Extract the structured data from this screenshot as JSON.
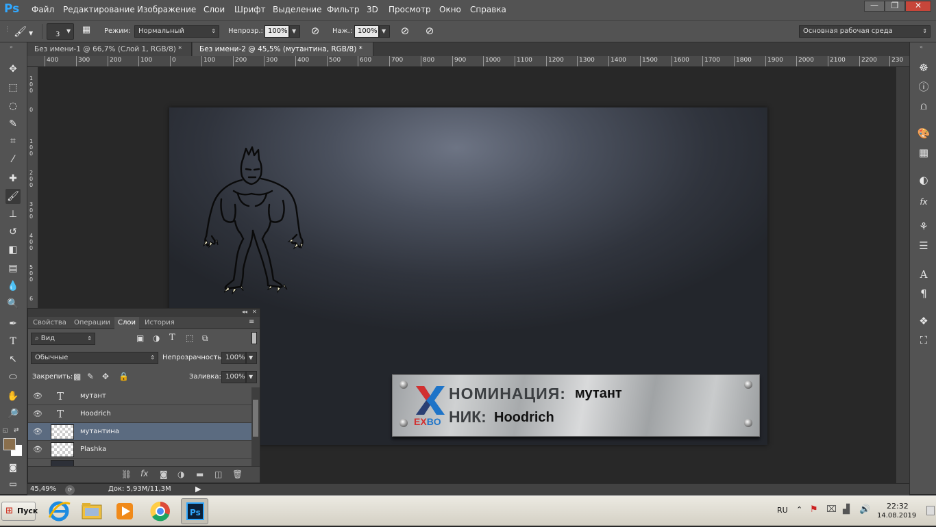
{
  "app": {
    "logo": "Ps",
    "name": "Photoshop"
  },
  "menu": [
    "Файл",
    "Редактирование",
    "Изображение",
    "Слои",
    "Шрифт",
    "Выделение",
    "Фильтр",
    "3D",
    "Просмотр",
    "Окно",
    "Справка"
  ],
  "window_buttons": {
    "minimize": "—",
    "restore": "❐",
    "close": "✕"
  },
  "options": {
    "brush_size": "3",
    "mode_label": "Режим:",
    "mode_value": "Нормальный",
    "opacity_label": "Непрозр.:",
    "opacity_value": "100%",
    "pressure_label": "Наж.:",
    "pressure_value": "100%",
    "workspace": "Основная рабочая среда"
  },
  "doc_tabs": [
    {
      "label": "Без имени-1 @ 66,7% (Слой 1, RGB/8) *",
      "close": "×"
    },
    {
      "label": "Без имени-2 @ 45,5% (мутантина, RGB/8) *",
      "close": "×"
    }
  ],
  "ruler_h": [
    "400",
    "300",
    "200",
    "100",
    "0",
    "100",
    "200",
    "300",
    "400",
    "500",
    "600",
    "700",
    "800",
    "900",
    "1000",
    "1100",
    "1200",
    "1300",
    "1400",
    "1500",
    "1600",
    "1700",
    "1800",
    "1900",
    "2000",
    "2100",
    "2200",
    "230"
  ],
  "ruler_v": [
    "1\n0\n0",
    "0",
    "1\n0\n0",
    "2\n0\n0",
    "3\n0\n0",
    "4\n0\n0",
    "5\n0\n0",
    "6"
  ],
  "plaque": {
    "nomination_label": "НОМИНАЦИЯ:",
    "nomination_value": "мутант",
    "nick_label": "НИК:",
    "nick_value": "Hoodrich",
    "logo_text": "EXBO"
  },
  "layers_panel": {
    "collapse": "◂◂",
    "close": "✕",
    "menu": "≡",
    "tabs": [
      "Свойства",
      "Операции",
      "Слои",
      "История"
    ],
    "active_tab": "Слои",
    "filter_kind": "Вид",
    "blend_mode": "Обычные",
    "opacity_label": "Непрозрачность:",
    "opacity_value": "100%",
    "lock_label": "Закрепить:",
    "fill_label": "Заливка:",
    "fill_value": "100%",
    "layers": [
      {
        "name": "мутант",
        "kind": "text"
      },
      {
        "name": "Hoodrich",
        "kind": "text"
      },
      {
        "name": "мутантина",
        "kind": "raster",
        "selected": true
      },
      {
        "name": "Plashka",
        "kind": "smart"
      }
    ]
  },
  "status": {
    "zoom": "45,49%",
    "doc": "Док: 5,93M/11,3M"
  },
  "taskbar": {
    "start": "Пуск",
    "apps": [
      "Internet Explorer",
      "Explorer",
      "Media Player",
      "Google Chrome",
      "Photoshop"
    ],
    "lang": "RU",
    "time": "22:32",
    "date": "14.08.2019"
  },
  "colors": {
    "chrome": "#535353",
    "canvas_bg": "#282828",
    "selected_layer": "#5b6b80",
    "ps_blue": "#31a8ff"
  }
}
